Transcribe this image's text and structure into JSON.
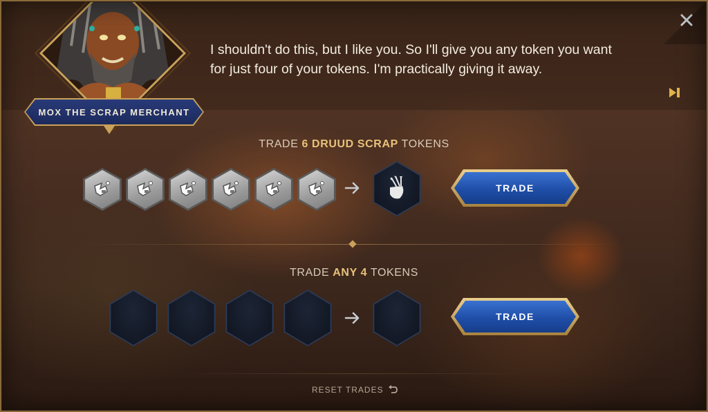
{
  "merchant": {
    "name": "MOX THE SCRAP MERCHANT",
    "dialog": "I shouldn't do this, but I like you. So I'll give you any token you want for just four of your tokens. I'm practically giving it away."
  },
  "trade_1": {
    "title_prefix": "TRADE ",
    "title_highlight": "6 DRUUD SCRAP",
    "title_suffix": " TOKENS",
    "input_token_icon": "druud-scrap-icon",
    "input_count": 6,
    "output_token_icon": "quiver-icon",
    "button_label": "TRADE"
  },
  "trade_2": {
    "title_prefix": "TRADE ",
    "title_highlight": "ANY 4",
    "title_suffix": " TOKENS",
    "input_count": 4,
    "button_label": "TRADE"
  },
  "reset_label": "RESET TRADES",
  "colors": {
    "gold": "#c9a25a",
    "highlight": "#e8c27a",
    "button_blue": "#1f4ea8",
    "nameplate_blue": "#233470"
  }
}
